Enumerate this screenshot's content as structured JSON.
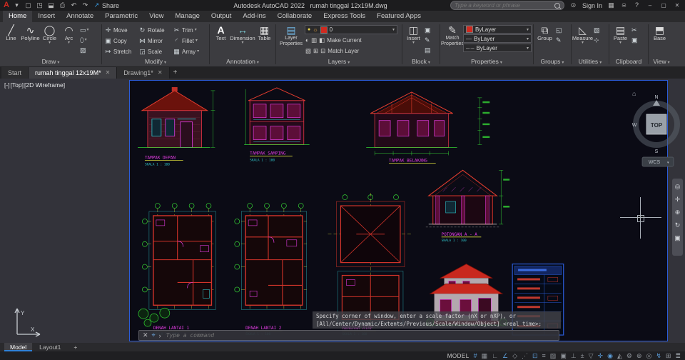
{
  "titlebar": {
    "app_title": "Autodesk AutoCAD 2022",
    "doc_title": "rumah tinggal 12x19M.dwg",
    "share_label": "Share",
    "search_placeholder": "Type a keyword or phrase",
    "sign_in_label": "Sign In"
  },
  "ribbon": {
    "tabs": [
      "Home",
      "Insert",
      "Annotate",
      "Parametric",
      "View",
      "Manage",
      "Output",
      "Add-ins",
      "Collaborate",
      "Express Tools",
      "Featured Apps"
    ],
    "draw": {
      "label": "Draw",
      "tools": [
        "Line",
        "Polyline",
        "Circle",
        "Arc"
      ]
    },
    "modify": {
      "label": "Modify",
      "tools": [
        "Move",
        "Rotate",
        "Trim",
        "Copy",
        "Mirror",
        "Fillet",
        "Stretch",
        "Scale",
        "Array"
      ]
    },
    "annotation": {
      "label": "Annotation",
      "tools": [
        "Text",
        "Dimension",
        "Table"
      ]
    },
    "layers": {
      "label": "Layers",
      "big": "Layer Properties",
      "current_layer": "0",
      "make_current": "Make Current",
      "match_layer": "Match Layer"
    },
    "block": {
      "label": "Block",
      "big": "Insert"
    },
    "properties": {
      "label": "Properties",
      "big": "Match Properties",
      "color_value": "ByLayer",
      "lineweight_value": "ByLayer",
      "linetype_value": "ByLayer"
    },
    "groups": {
      "label": "Groups",
      "big": "Group"
    },
    "utilities": {
      "label": "Utilities",
      "big": "Measure"
    },
    "clipboard": {
      "label": "Clipboard",
      "big": "Paste"
    },
    "view": {
      "label": "View",
      "big": "Base"
    }
  },
  "file_tabs": {
    "start": "Start",
    "doc1": "rumah tinggal 12x19M*",
    "doc2": "Drawing1*",
    "add": "+"
  },
  "viewport": {
    "controls": {
      "minus": "[-]",
      "view": "[Top]",
      "visual": "[2D Wireframe]"
    },
    "viewcube": {
      "north": "N",
      "west": "W",
      "south": "S",
      "top": "TOP",
      "wcs": "WCS"
    },
    "ucs": {
      "x": "X",
      "y": "Y"
    }
  },
  "drawing": {
    "labels": {
      "front": "TAMPAK DEPAN",
      "side": "TAMPAK SAMPING",
      "rear": "TAMPAK BELAKANG",
      "plan1": "DENAH LANTAI 1",
      "plan2": "DENAH LANTAI 2",
      "roof": "RENCANA ATAP",
      "section": "POTONGAN A - A",
      "scale": "SKALA 1 : 100"
    },
    "palette": {
      "red": "#d2342a",
      "magenta": "#e23ce2",
      "cyan": "#2fc2c8",
      "green": "#35d435",
      "yellow": "#d8d83a",
      "blue": "#2b5cd9"
    }
  },
  "command_line": {
    "history1": "Specify corner of window, enter a scale factor (nX or nXP), or",
    "history2": "[All/Center/Dynamic/Extents/Previous/Scale/Window/Object] <real time>:",
    "input_placeholder": "Type a command"
  },
  "layout_tabs": {
    "model": "Model",
    "layout1": "Layout1",
    "add": "+"
  },
  "status_bar": {
    "model_label": "MODEL"
  }
}
